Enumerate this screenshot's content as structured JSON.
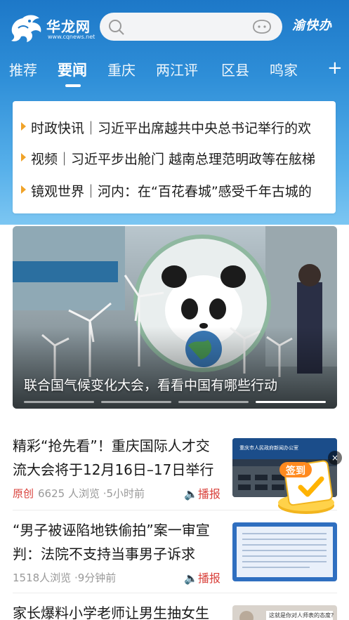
{
  "header": {
    "logo_name": "华龙网",
    "logo_url": "www.cqnews.net",
    "brand_right": "渝快办",
    "icons": [
      "dragon-logo-icon",
      "search-icon",
      "voice-icon"
    ]
  },
  "tabs": [
    {
      "label": "推荐"
    },
    {
      "label": "要闻"
    },
    {
      "label": "重庆"
    },
    {
      "label": "两江评"
    },
    {
      "label": "区县"
    },
    {
      "label": "鸣家"
    }
  ],
  "tabs_plus": "+",
  "headlines": [
    "时政快讯｜习近平出席越共中央总书记举行的欢",
    "视频｜习近平步出舱门 越南总理范明政等在舷梯",
    "镜观世界｜河内：在“百花春城”感受千年古城的"
  ],
  "hero": {
    "caption": "联合国气候变化大会，看看中国有哪些行动",
    "slides": 4,
    "active_slide": 4
  },
  "articles": [
    {
      "title": "精彩“抢先看”！重庆国际人才交流大会将于12月16日–17日举行",
      "badge": "原创",
      "meta": "6625 人浏览 ·5小时前",
      "play": "播报"
    },
    {
      "title": "“男子被诬陷地铁偷拍”案一审宣判：法院不支持当事男子诉求",
      "badge": "",
      "meta": "1518人浏览 ·9分钟前",
      "play": "播报"
    },
    {
      "title": "家长爆料小学老师让男生抽女生",
      "badge": "",
      "meta": "",
      "play": ""
    }
  ],
  "floating": {
    "signin_label": "签到",
    "close": "×"
  },
  "thumb_texts": {
    "thumb1_banner": "重庆市人民政府新闻办公室",
    "thumb3_caption": "这就是你对人师表的态度?"
  },
  "colors": {
    "header_top": "#1d78c8",
    "header_bottom": "#7cc6f2",
    "bullet": "#f0a329",
    "accent_red": "#d9413b"
  }
}
